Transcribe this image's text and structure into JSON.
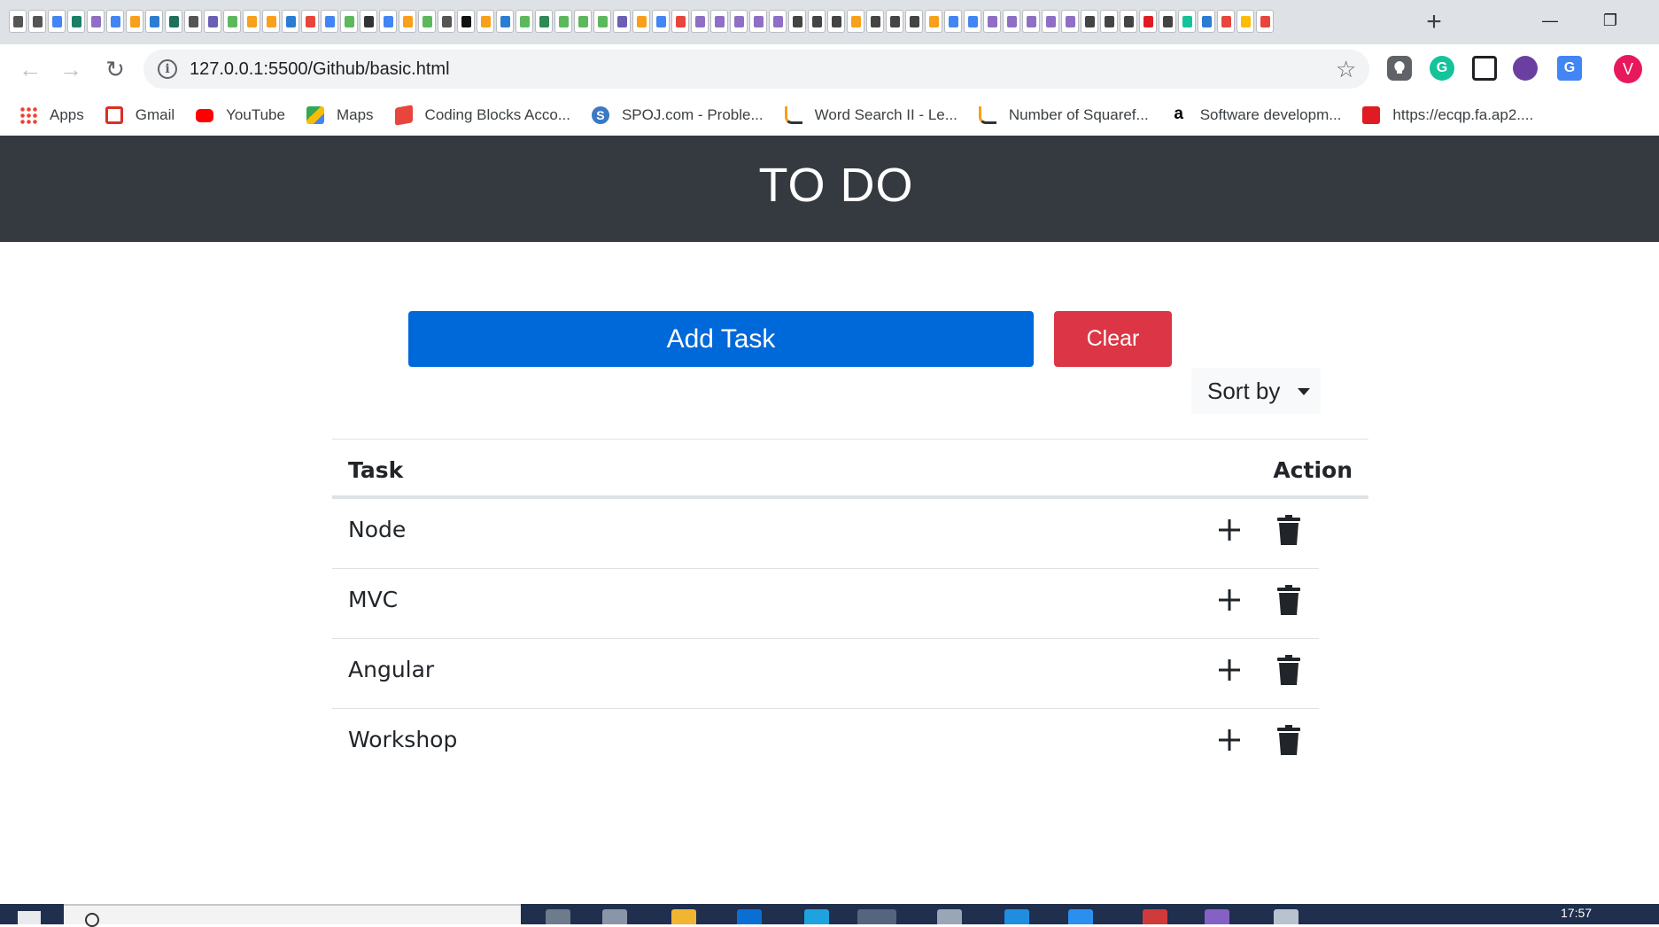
{
  "browser": {
    "new_tab_glyph": "+",
    "minimize_glyph": "—",
    "maximize_glyph": "❐",
    "tab_favicons": [
      "#555",
      "#555",
      "#4285f4",
      "#1a7f64",
      "#8e6fc5",
      "#4285f4",
      "#f89f1b",
      "#2b7cd3",
      "#1e6f5c",
      "#555",
      "#6b5fb5",
      "#5cb85c",
      "#f89f1b",
      "#f89f1b",
      "#2b7cd3",
      "#e8453c",
      "#4285f4",
      "#5cb85c",
      "#333",
      "#4285f4",
      "#f89f1b",
      "#5cb85c",
      "#555",
      "#111",
      "#f89f1b",
      "#2b7cd3",
      "#5cb85c",
      "#2e8b57",
      "#5cb85c",
      "#5cb85c",
      "#5cb85c",
      "#6b5fb5",
      "#f89f1b",
      "#4285f4",
      "#e8453c",
      "#8e6fc5",
      "#8e6fc5",
      "#8e6fc5",
      "#8e6fc5",
      "#8e6fc5",
      "#444",
      "#444",
      "#444",
      "#f89f1b",
      "#444",
      "#444",
      "#444",
      "#f89f1b",
      "#4285f4",
      "#4285f4",
      "#8e6fc5",
      "#8e6fc5",
      "#8e6fc5",
      "#8e6fc5",
      "#8e6fc5",
      "#444",
      "#444",
      "#444",
      "#e11b22",
      "#444",
      "#15c39a",
      "#2b7cd3",
      "#e8453c",
      "#fbbc04",
      "#e8453c"
    ],
    "back_glyph": "←",
    "forward_glyph": "→",
    "reload_glyph": "↻",
    "info_glyph": "i",
    "url": "127.0.0.1:5500/Github/basic.html",
    "star_glyph": "☆",
    "avatar_initial": "V",
    "bookmarks": [
      {
        "label": "Apps",
        "icon": "apps-grid-icon"
      },
      {
        "label": "Gmail",
        "icon": "gmail-icon"
      },
      {
        "label": "YouTube",
        "icon": "youtube-icon"
      },
      {
        "label": "Maps",
        "icon": "maps-icon"
      },
      {
        "label": "Coding Blocks Acco...",
        "icon": "coding-blocks-icon"
      },
      {
        "label": "SPOJ.com - Proble...",
        "icon": "spoj-icon"
      },
      {
        "label": "Word Search II - Le...",
        "icon": "leetcode-icon"
      },
      {
        "label": "Number of Squaref...",
        "icon": "leetcode-icon"
      },
      {
        "label": "Software developm...",
        "icon": "amazon-icon"
      },
      {
        "label": "https://ecqp.fa.ap2....",
        "icon": "oracle-icon"
      }
    ]
  },
  "app": {
    "title": "TO DO",
    "add_task_label": "Add Task",
    "clear_label": "Clear",
    "sort_label": "Sort by",
    "table": {
      "headers": {
        "task": "Task",
        "action": "Action"
      },
      "rows": [
        {
          "task": "Node"
        },
        {
          "task": "MVC"
        },
        {
          "task": "Angular"
        },
        {
          "task": "Workshop"
        }
      ]
    }
  },
  "taskbar": {
    "time": "17:57"
  }
}
